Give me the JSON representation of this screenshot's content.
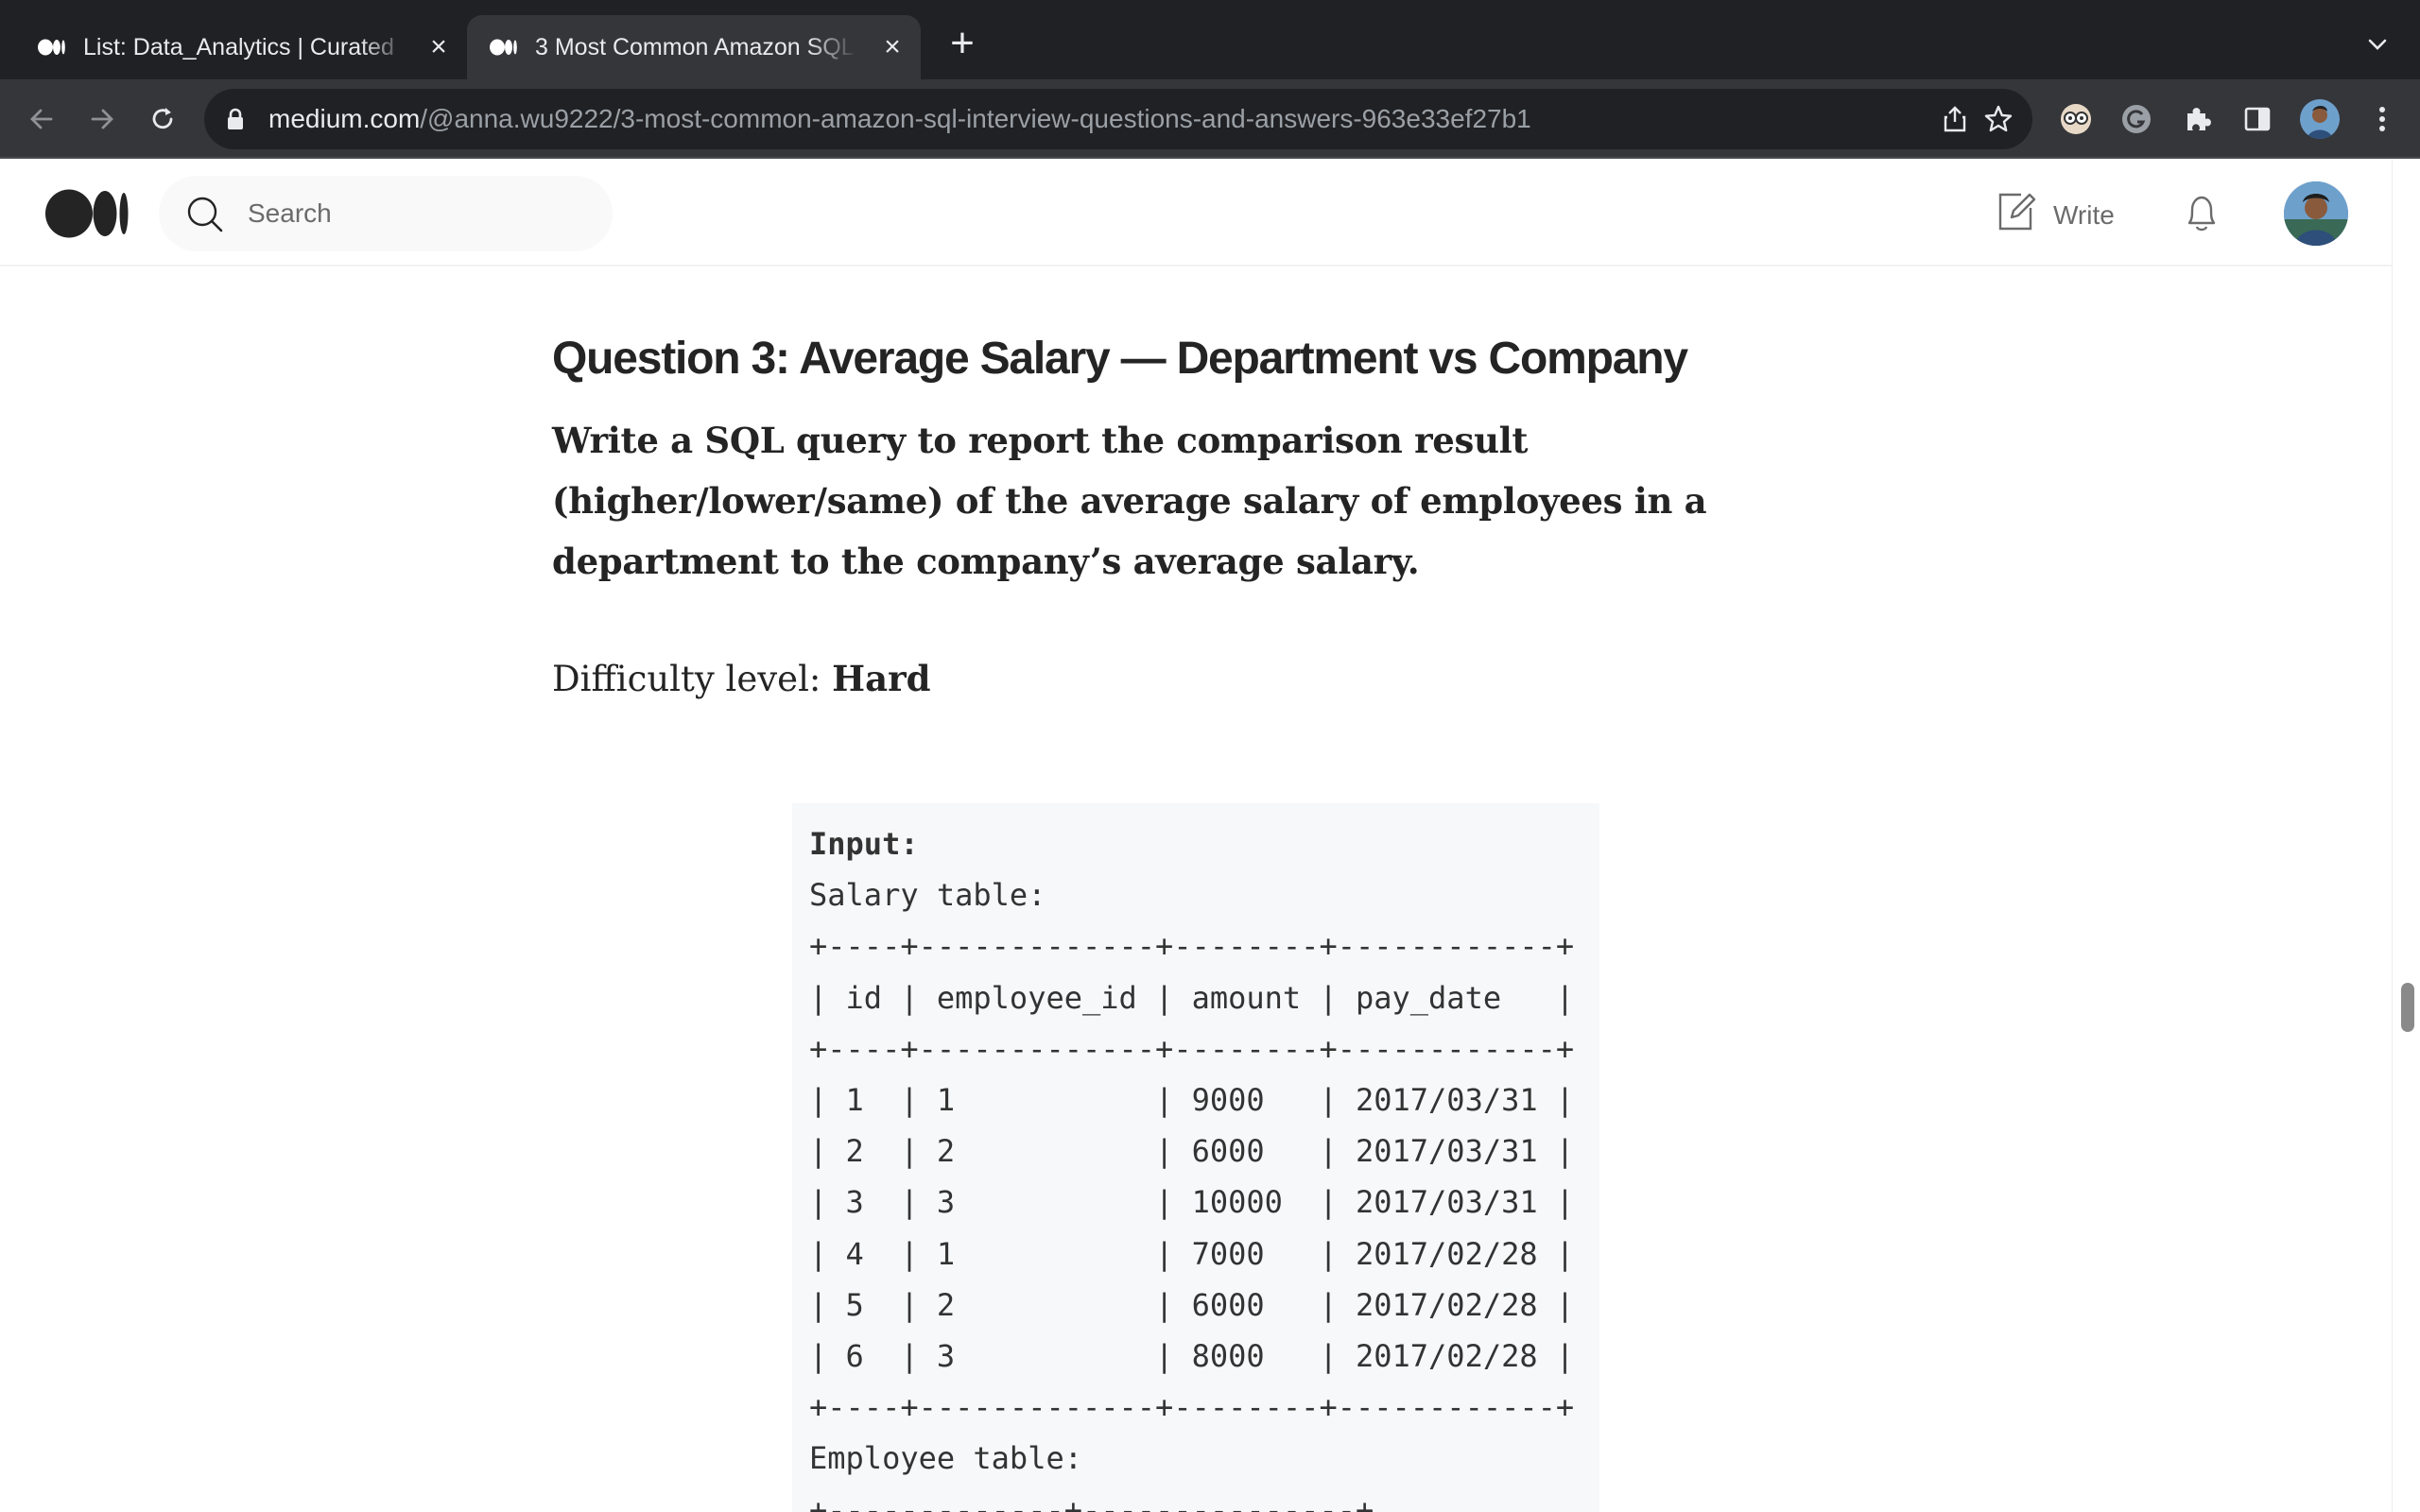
{
  "browser": {
    "tabs": [
      {
        "title": "List: Data_Analytics | Curated",
        "active": false
      },
      {
        "title": "3 Most Common Amazon SQL",
        "active": true
      }
    ],
    "url_host": "medium.com",
    "url_path": "/@anna.wu9222/3-most-common-amazon-sql-interview-questions-and-answers-963e33ef27b1",
    "colors": {
      "tabstrip": "#202124",
      "toolbar": "#35363a",
      "omnibox": "#202124"
    }
  },
  "header": {
    "search_placeholder": "Search",
    "write_label": "Write"
  },
  "article": {
    "question_title": "Question 3: Average Salary — Department vs Company",
    "prompt": "Write a SQL query to report the comparison result (higher/lower/same) of the average salary of employees in a department to the company’s average salary.",
    "difficulty_label": "Difficulty level: ",
    "difficulty_value": "Hard",
    "code": {
      "input_label": "Input:",
      "lines": [
        "Salary table:",
        "+----+-------------+--------+------------+",
        "| id | employee_id | amount | pay_date   |",
        "+----+-------------+--------+------------+",
        "| 1  | 1           | 9000   | 2017/03/31 |",
        "| 2  | 2           | 6000   | 2017/03/31 |",
        "| 3  | 3           | 10000  | 2017/03/31 |",
        "| 4  | 1           | 7000   | 2017/02/28 |",
        "| 5  | 2           | 6000   | 2017/02/28 |",
        "| 6  | 3           | 8000   | 2017/02/28 |",
        "+----+-------------+--------+------------+",
        "Employee table:",
        "+-------------+---------------+"
      ]
    }
  }
}
